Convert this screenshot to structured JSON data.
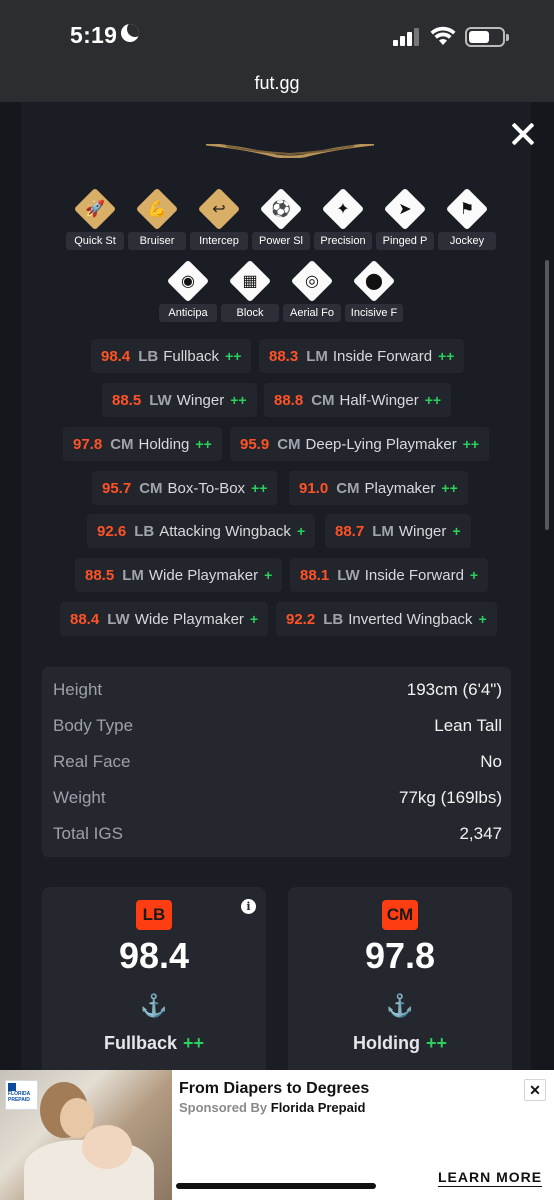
{
  "status_bar": {
    "time": "5:19"
  },
  "browser": {
    "url": "fut.gg"
  },
  "playstyles": [
    {
      "label": "Quick St",
      "icon": "rocket-icon",
      "glyph": "🚀",
      "tier": "gold"
    },
    {
      "label": "Bruiser",
      "icon": "flexed-arm-icon",
      "glyph": "💪",
      "tier": "gold"
    },
    {
      "label": "Intercep",
      "icon": "hook-icon",
      "glyph": "↩",
      "tier": "gold"
    },
    {
      "label": "Power Sl",
      "icon": "power-shot-ball-icon",
      "glyph": "⚽",
      "tier": "white"
    },
    {
      "label": "Precision",
      "icon": "precision-pass-icon",
      "glyph": "✦",
      "tier": "white"
    },
    {
      "label": "Pinged P",
      "icon": "pinged-pass-arrow-icon",
      "glyph": "➤",
      "tier": "white"
    },
    {
      "label": "Jockey",
      "icon": "jockey-icon",
      "glyph": "⚑",
      "tier": "white"
    },
    {
      "label": "Anticipa",
      "icon": "raccoon-icon",
      "glyph": "◉",
      "tier": "white"
    },
    {
      "label": "Block",
      "icon": "barrier-icon",
      "glyph": "▦",
      "tier": "white"
    },
    {
      "label": "Aerial Fo",
      "icon": "aerial-fortress-icon",
      "glyph": "◎",
      "tier": "white"
    },
    {
      "label": "Incisive F",
      "icon": "location-pin-icon",
      "glyph": "⬤",
      "tier": "white"
    }
  ],
  "roles": [
    {
      "value": "98.4",
      "pos": "LB",
      "name": "Fullback",
      "plus": "++"
    },
    {
      "value": "88.3",
      "pos": "LM",
      "name": "Inside Forward",
      "plus": "++"
    },
    {
      "value": "88.5",
      "pos": "LW",
      "name": "Winger",
      "plus": "++"
    },
    {
      "value": "88.8",
      "pos": "CM",
      "name": "Half-Winger",
      "plus": "++"
    },
    {
      "value": "97.8",
      "pos": "CM",
      "name": "Holding",
      "plus": "++"
    },
    {
      "value": "95.9",
      "pos": "CM",
      "name": "Deep-Lying Playmaker",
      "plus": "++"
    },
    {
      "value": "95.7",
      "pos": "CM",
      "name": "Box-To-Box",
      "plus": "++"
    },
    {
      "value": "91.0",
      "pos": "CM",
      "name": "Playmaker",
      "plus": "++"
    },
    {
      "value": "92.6",
      "pos": "LB",
      "name": "Attacking Wingback",
      "plus": "+"
    },
    {
      "value": "88.7",
      "pos": "LM",
      "name": "Winger",
      "plus": "+"
    },
    {
      "value": "88.5",
      "pos": "LM",
      "name": "Wide Playmaker",
      "plus": "+"
    },
    {
      "value": "88.1",
      "pos": "LW",
      "name": "Inside Forward",
      "plus": "+"
    },
    {
      "value": "88.4",
      "pos": "LW",
      "name": "Wide Playmaker",
      "plus": "+"
    },
    {
      "value": "92.2",
      "pos": "LB",
      "name": "Inverted Wingback",
      "plus": "+"
    }
  ],
  "info": [
    {
      "label": "Height",
      "value": "193cm (6'4\")"
    },
    {
      "label": "Body Type",
      "value": "Lean Tall"
    },
    {
      "label": "Real Face",
      "value": "No"
    },
    {
      "label": "Weight",
      "value": "77kg (169lbs)"
    },
    {
      "label": "Total IGS",
      "value": "2,347"
    }
  ],
  "cards": [
    {
      "pos": "LB",
      "rating": "98.4",
      "role": "Fullback",
      "plus": "++",
      "icon": "anchor-icon"
    },
    {
      "pos": "CM",
      "rating": "97.8",
      "role": "Holding",
      "plus": "++",
      "icon": "anchor-icon"
    }
  ],
  "ad": {
    "title": "From Diapers to Degrees",
    "sponsor_prefix": "Sponsored By",
    "sponsor": "Florida Prepaid",
    "cta": "LEARN MORE",
    "logo_text": "FLORIDA PREPAID"
  },
  "colors": {
    "rating_accent": "#ff5326",
    "plus_green": "#2ad15d",
    "gold_playstyle": "#d9ae67",
    "badge": "#ff3d12"
  }
}
